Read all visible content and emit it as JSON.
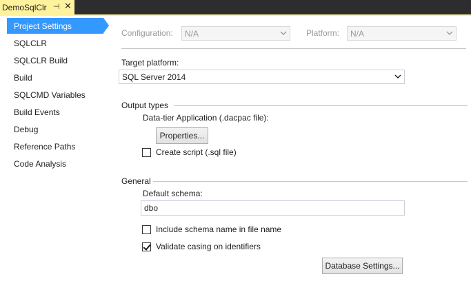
{
  "tab": {
    "title": "DemoSqlClr",
    "pin": "⊣",
    "close": "✕"
  },
  "sidebar": {
    "items": [
      {
        "label": "Project Settings"
      },
      {
        "label": "SQLCLR"
      },
      {
        "label": "SQLCLR Build"
      },
      {
        "label": "Build"
      },
      {
        "label": "SQLCMD Variables"
      },
      {
        "label": "Build Events"
      },
      {
        "label": "Debug"
      },
      {
        "label": "Reference Paths"
      },
      {
        "label": "Code Analysis"
      }
    ],
    "active_index": 0
  },
  "config": {
    "configuration_label": "Configuration:",
    "configuration_value": "N/A",
    "platform_label": "Platform:",
    "platform_value": "N/A"
  },
  "target_platform": {
    "label": "Target platform:",
    "value": "SQL Server 2014"
  },
  "output_types": {
    "header": "Output types",
    "dacpac_label": "Data-tier Application (.dacpac file):",
    "properties_button": "Properties...",
    "create_script_label": "Create script (.sql file)",
    "create_script_checked": false
  },
  "general": {
    "header": "General",
    "default_schema_label": "Default schema:",
    "default_schema_value": "dbo",
    "include_schema_label": "Include schema name in file name",
    "include_schema_checked": false,
    "validate_casing_label": "Validate casing on identifiers",
    "validate_casing_checked": true,
    "database_settings_button": "Database Settings..."
  },
  "colors": {
    "accent": "#3399ff",
    "tab_active": "#fff29d",
    "titlebar": "#2d2d30"
  },
  "icons": {
    "pin": "pin-icon",
    "close": "close-icon",
    "dropdown": "chevron-down-icon",
    "check": "checkmark-icon"
  }
}
